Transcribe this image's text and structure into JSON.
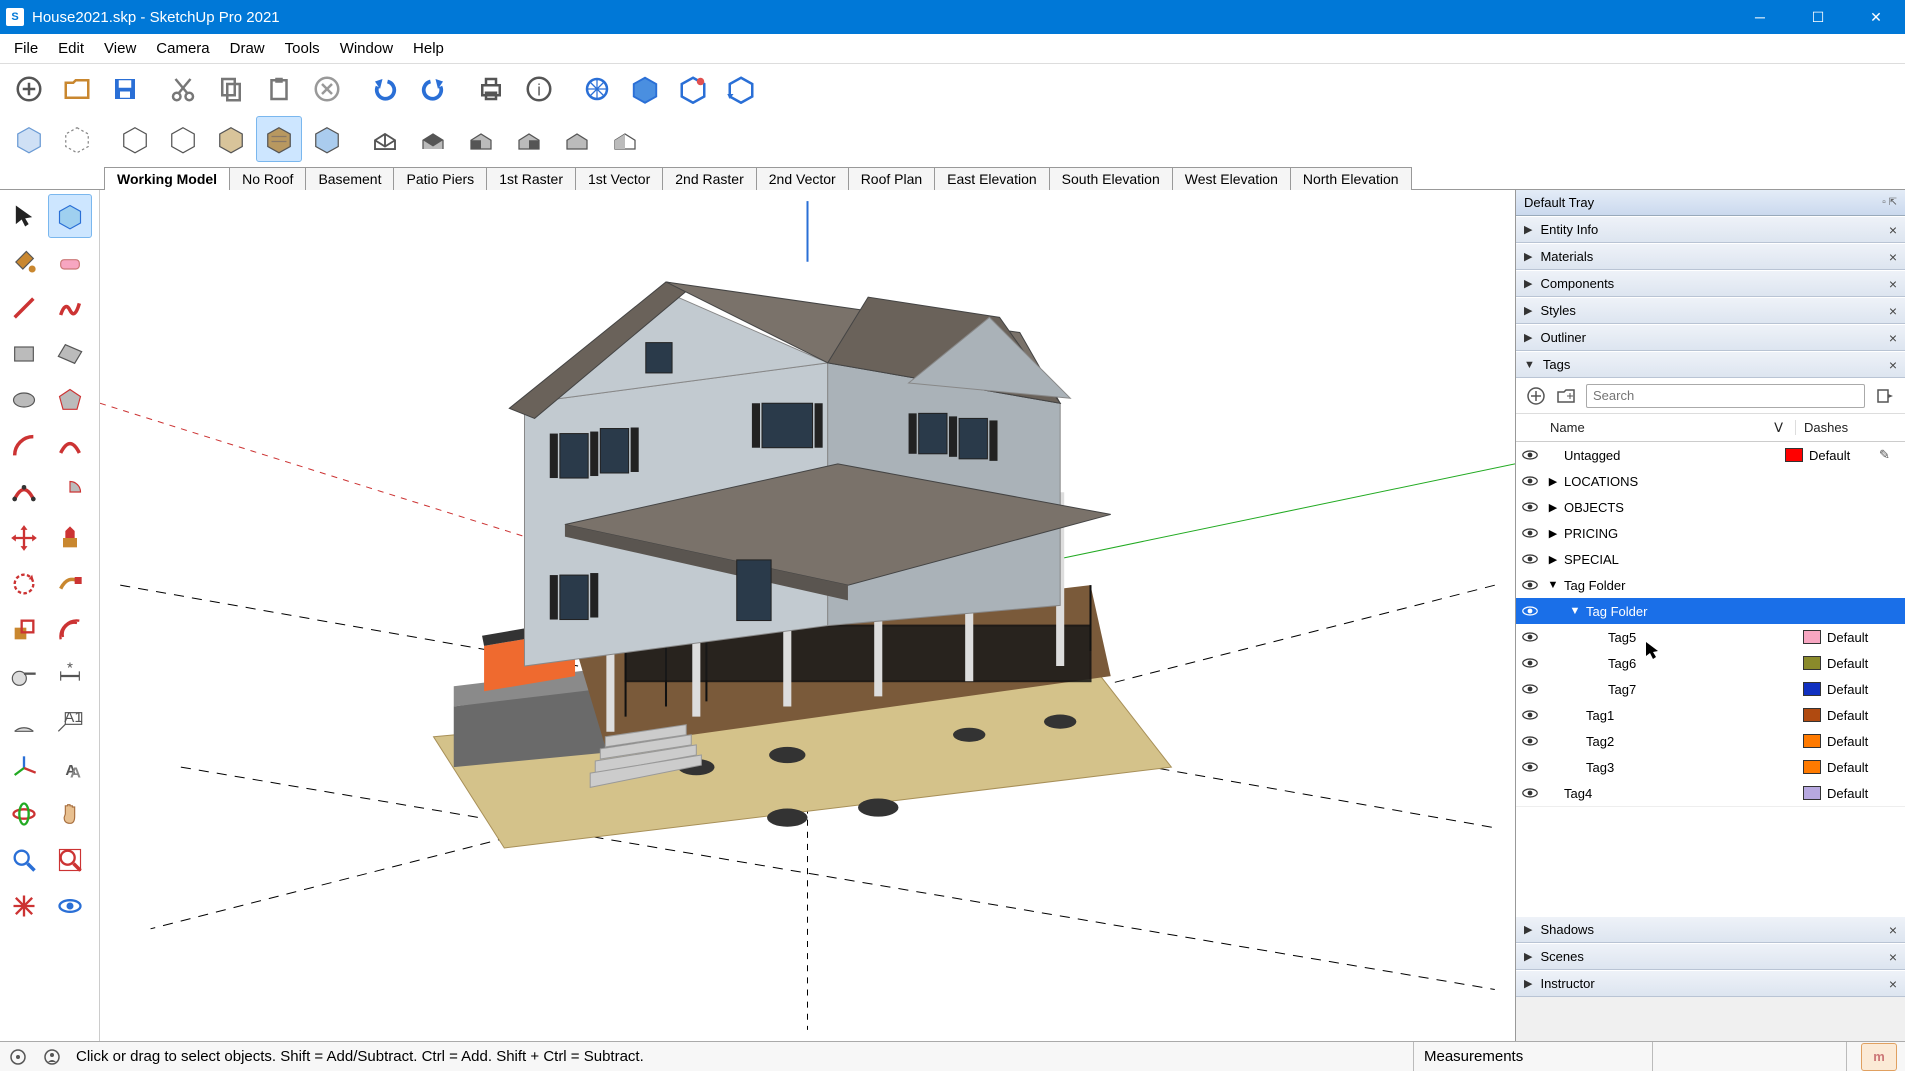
{
  "window": {
    "title": "House2021.skp - SketchUp Pro 2021"
  },
  "menu": [
    "File",
    "Edit",
    "View",
    "Camera",
    "Draw",
    "Tools",
    "Window",
    "Help"
  ],
  "scene_tabs": [
    "Working Model",
    "No Roof",
    "Basement",
    "Patio Piers",
    "1st Raster",
    "1st Vector",
    "2nd Raster",
    "2nd Vector",
    "Roof Plan",
    "East Elevation",
    "South Elevation",
    "West Elevation",
    "North Elevation"
  ],
  "tray": {
    "title": "Default Tray",
    "panels": [
      "Entity Info",
      "Materials",
      "Components",
      "Styles",
      "Outliner",
      "Tags",
      "Shadows",
      "Scenes",
      "Instructor"
    ],
    "tags": {
      "search_placeholder": "Search",
      "columns": {
        "name": "Name",
        "dashes": "Dashes"
      },
      "rows": [
        {
          "vis": true,
          "indent": 0,
          "expand": "",
          "name": "Untagged",
          "color": "#ff0000",
          "dashes": "Default",
          "editable": true
        },
        {
          "vis": true,
          "indent": 0,
          "expand": "▶",
          "name": "LOCATIONS",
          "color": "",
          "dashes": ""
        },
        {
          "vis": true,
          "indent": 0,
          "expand": "▶",
          "name": "OBJECTS",
          "color": "",
          "dashes": ""
        },
        {
          "vis": true,
          "indent": 0,
          "expand": "▶",
          "name": "PRICING",
          "color": "",
          "dashes": ""
        },
        {
          "vis": true,
          "indent": 0,
          "expand": "▶",
          "name": "SPECIAL",
          "color": "",
          "dashes": ""
        },
        {
          "vis": true,
          "indent": 0,
          "expand": "▼",
          "name": "Tag Folder",
          "color": "",
          "dashes": ""
        },
        {
          "vis": true,
          "indent": 1,
          "expand": "▼",
          "name": "Tag Folder",
          "color": "",
          "dashes": "",
          "selected": true
        },
        {
          "vis": true,
          "indent": 2,
          "expand": "",
          "name": "Tag5",
          "color": "#f7a6c1",
          "dashes": "Default"
        },
        {
          "vis": true,
          "indent": 2,
          "expand": "",
          "name": "Tag6",
          "color": "#8a8a2b",
          "dashes": "Default"
        },
        {
          "vis": true,
          "indent": 2,
          "expand": "",
          "name": "Tag7",
          "color": "#1030c0",
          "dashes": "Default"
        },
        {
          "vis": true,
          "indent": 1,
          "expand": "",
          "name": "Tag1",
          "color": "#b04a10",
          "dashes": "Default"
        },
        {
          "vis": true,
          "indent": 1,
          "expand": "",
          "name": "Tag2",
          "color": "#ff7a00",
          "dashes": "Default"
        },
        {
          "vis": true,
          "indent": 1,
          "expand": "",
          "name": "Tag3",
          "color": "#ff7a00",
          "dashes": "Default"
        },
        {
          "vis": true,
          "indent": 0,
          "expand": "",
          "name": "Tag4",
          "color": "#b7a8e0",
          "dashes": "Default"
        }
      ]
    }
  },
  "statusbar": {
    "hint": "Click or drag to select objects. Shift = Add/Subtract. Ctrl = Add. Shift + Ctrl = Subtract.",
    "measurements_label": "Measurements",
    "corner": "m"
  }
}
